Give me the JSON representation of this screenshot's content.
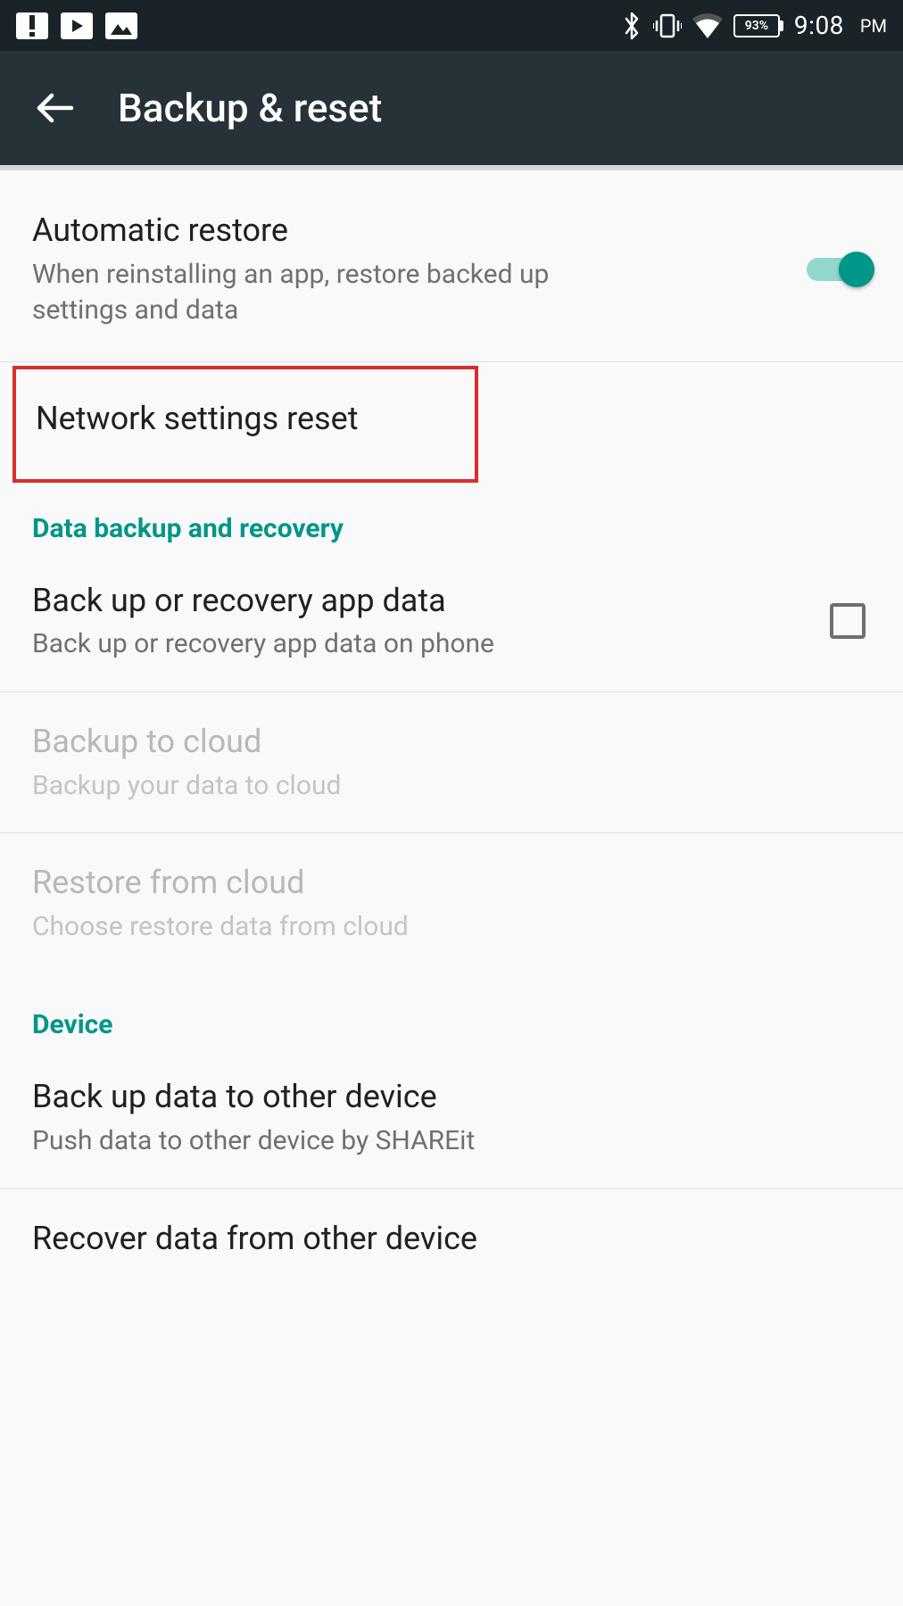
{
  "statusbar": {
    "battery_pct": "93%",
    "time": "9:08",
    "ampm": "PM"
  },
  "appbar": {
    "title": "Backup & reset"
  },
  "items": {
    "auto_restore": {
      "title": "Automatic restore",
      "sub": "When reinstalling an app, restore backed up settings and data"
    },
    "network_reset": {
      "title": "Network settings reset"
    },
    "section_data": "Data backup and recovery",
    "backup_recovery": {
      "title": "Back up or recovery app data",
      "sub": "Back up or recovery app data on phone"
    },
    "backup_cloud": {
      "title": "Backup to cloud",
      "sub": "Backup your data to cloud"
    },
    "restore_cloud": {
      "title": "Restore from cloud",
      "sub": "Choose restore data from cloud"
    },
    "section_device": "Device",
    "backup_other": {
      "title": "Back up data to other device",
      "sub": "Push data to other device by SHAREit"
    },
    "recover_other": {
      "title": "Recover data from other device"
    }
  }
}
